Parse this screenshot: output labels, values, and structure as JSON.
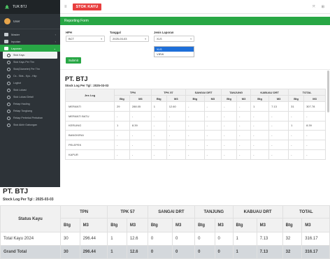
{
  "app": {
    "brand": "TUK BTJ",
    "page_title": "STOK KAYU"
  },
  "sidebar": {
    "user": "User",
    "items": [
      {
        "label": "Master"
      },
      {
        "label": "Inputan"
      },
      {
        "label": "Laporan"
      }
    ],
    "subitems": [
      {
        "label": "Stok Kayu"
      },
      {
        "label": "Stok Kayu Per Thn"
      },
      {
        "label": "Stok(Diameter) Per Thn"
      },
      {
        "label": "Cs - Skts - Kyu - Hkp"
      },
      {
        "label": "Logbot"
      },
      {
        "label": "Stok Lokasi"
      },
      {
        "label": "Stok Lokasi Detail"
      },
      {
        "label": "Rekap Hauling"
      },
      {
        "label": "Rekap Tongkang"
      },
      {
        "label": "Rekap Perbekal Perbahan"
      },
      {
        "label": "Stok Akhir Gabungan"
      }
    ]
  },
  "form": {
    "header": "Reporting Form",
    "hph": {
      "label": "HPH",
      "value": "BCT"
    },
    "tanggal": {
      "label": "Tanggal",
      "value": "2025-03-03"
    },
    "jenis": {
      "label": "Jenis Laporan",
      "value": "XLS",
      "options": [
        "XLS",
        "VIEW"
      ]
    },
    "submit": "Submit"
  },
  "report": {
    "title": "PT. BTJ",
    "subtitle": "Stock Log Per Tgl : 2025-03-03",
    "title_cut": "PT. BTJ",
    "headers": {
      "jns_log": "Jns Log",
      "status": "Status Kayu",
      "groups": [
        "TPN",
        "TPK 57",
        "SANGAI DRT",
        "TANJUNG",
        "KABUAU DRT",
        "TOTAL"
      ],
      "btg": "Btg",
      "m3": "M3"
    },
    "rows": [
      {
        "name": "MERANTI",
        "cells": [
          "29",
          "288.05",
          "1",
          "12.60",
          "-",
          "-",
          "-",
          "-",
          "1",
          "7.13",
          "31",
          "307.78"
        ]
      },
      {
        "name": "MERANTI BATU",
        "cells": [
          "-",
          "-",
          "-",
          "-",
          "-",
          "-",
          "-",
          "-",
          "-",
          "-",
          "-",
          "-"
        ]
      },
      {
        "name": "KERUING",
        "cells": [
          "1",
          "8.39",
          "-",
          "-",
          "-",
          "-",
          "-",
          "-",
          "-",
          "-",
          "1",
          "8.39"
        ]
      },
      {
        "name": "BANGKIRAI",
        "cells": [
          "-",
          "-",
          "-",
          "-",
          "-",
          "-",
          "-",
          "-",
          "-",
          "-",
          "-",
          "-"
        ]
      },
      {
        "name": "PELEPEK",
        "cells": [
          "-",
          "-",
          "-",
          "-",
          "-",
          "-",
          "-",
          "-",
          "-",
          "-",
          "-",
          "-"
        ]
      },
      {
        "name": "KAPUR",
        "cells": [
          "-",
          "-",
          "-",
          "-",
          "-",
          "-",
          "-",
          "-",
          "-",
          "-",
          "-",
          "-"
        ]
      }
    ],
    "summary": [
      {
        "name": "Total Kayu 2024",
        "cells": [
          "30",
          "296.44",
          "1",
          "12.6",
          "0",
          "0",
          "0",
          "0",
          "1",
          "7.13",
          "32",
          "316.17"
        ]
      },
      {
        "name": "Grand Total",
        "cells": [
          "30",
          "296.44",
          "1",
          "12.6",
          "0",
          "0",
          "0",
          "0",
          "1",
          "7.13",
          "32",
          "316.17"
        ]
      }
    ]
  },
  "colors": {
    "green": "#28a745",
    "red": "#e83e3e",
    "sidebar": "#2d3338",
    "blue": "#1e6fd9"
  }
}
